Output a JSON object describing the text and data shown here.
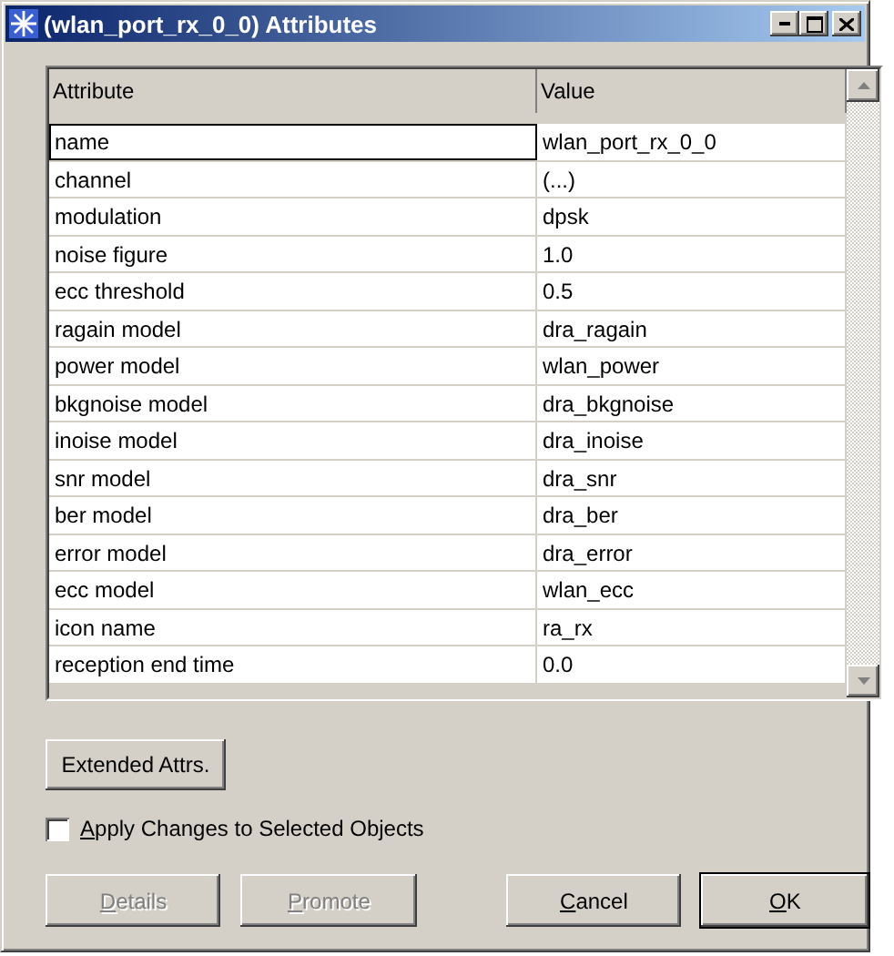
{
  "window": {
    "title": "(wlan_port_rx_0_0) Attributes"
  },
  "table": {
    "columns": [
      "Attribute",
      "Value"
    ],
    "rows": [
      {
        "attribute": "name",
        "value": "wlan_port_rx_0_0",
        "focused": true
      },
      {
        "attribute": "channel",
        "value": "(...)",
        "focused": false
      },
      {
        "attribute": "modulation",
        "value": "dpsk",
        "focused": false
      },
      {
        "attribute": "noise figure",
        "value": "1.0",
        "focused": false
      },
      {
        "attribute": "ecc threshold",
        "value": "0.5",
        "focused": false
      },
      {
        "attribute": "ragain model",
        "value": "dra_ragain",
        "focused": false
      },
      {
        "attribute": "power model",
        "value": "wlan_power",
        "focused": false
      },
      {
        "attribute": "bkgnoise model",
        "value": "dra_bkgnoise",
        "focused": false
      },
      {
        "attribute": "inoise model",
        "value": "dra_inoise",
        "focused": false
      },
      {
        "attribute": "snr model",
        "value": "dra_snr",
        "focused": false
      },
      {
        "attribute": "ber model",
        "value": "dra_ber",
        "focused": false
      },
      {
        "attribute": "error model",
        "value": "dra_error",
        "focused": false
      },
      {
        "attribute": "ecc model",
        "value": "wlan_ecc",
        "focused": false
      },
      {
        "attribute": "icon name",
        "value": "ra_rx",
        "focused": false
      },
      {
        "attribute": "reception end time",
        "value": "0.0",
        "focused": false
      }
    ]
  },
  "extended_button": {
    "label": "Extended Attrs.",
    "underline_first": false,
    "disabled": false,
    "default": false
  },
  "apply_checkbox": {
    "label": "Apply Changes to Selected Objects",
    "underline_first": true,
    "checked": false
  },
  "buttons": [
    {
      "label": "Details",
      "underline_first": true,
      "disabled": true,
      "default": false
    },
    {
      "label": "Promote",
      "underline_first": true,
      "disabled": true,
      "default": false
    },
    {
      "label": "Cancel",
      "underline_first": true,
      "disabled": false,
      "default": false
    },
    {
      "label": "OK",
      "underline_first": true,
      "disabled": false,
      "default": true
    }
  ]
}
